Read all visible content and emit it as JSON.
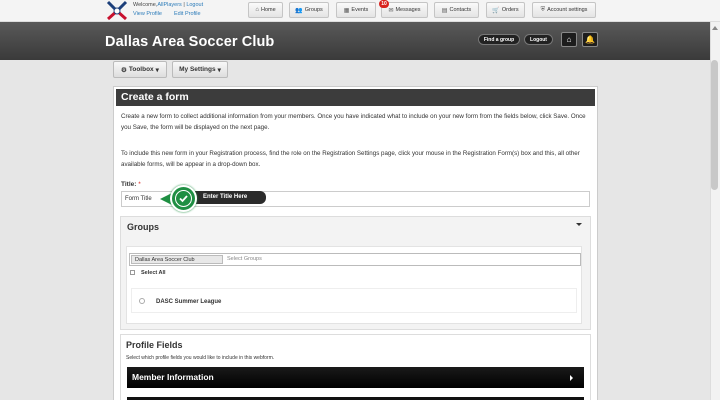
{
  "topbar": {
    "welcome_prefix": "Welcome,",
    "user_name": "AllPlayers",
    "separator": " | ",
    "logout": "Logout",
    "view_profile": "View Profile",
    "edit_profile": "Edit Profile",
    "nav": [
      {
        "label": "Home",
        "icon": "home-icon"
      },
      {
        "label": "Groups",
        "icon": "users-icon"
      },
      {
        "label": "Events",
        "icon": "calendar-icon"
      },
      {
        "label": "Messages",
        "icon": "envelope-icon"
      },
      {
        "label": "Contacts",
        "icon": "address-book-icon"
      },
      {
        "label": "Orders",
        "icon": "cart-icon"
      },
      {
        "label": "Account settings",
        "icon": "shield-icon"
      }
    ],
    "messages_badge": "10"
  },
  "header": {
    "club_name": "Dallas Area Soccer Club",
    "find_group": "Find a group",
    "logout": "Logout"
  },
  "toolbar": {
    "toolbox": "Toolbox",
    "my_settings": "My Settings"
  },
  "form": {
    "heading": "Create a form",
    "intro": "Create a new form to collect additional information from your members. Once you have indicated what to include on your new form from the fields below, click Save. Once you Save, the form will be displayed on the next page.",
    "registration_note": "To include this new form in your Registration process, find the role on the Registration Settings page, click your mouse in the Registration Form(s) box and this, all other available forms, will be appear in a drop-down box.",
    "title_label": "Title:",
    "required_mark": "*",
    "title_value": "Form Title",
    "tooltip": "Enter Title Here"
  },
  "groups": {
    "heading": "Groups",
    "selected_chip": "Dallas Area Soccer Club",
    "placeholder": "Select Groups",
    "select_all": "Select All",
    "items": [
      "DASC Summer League"
    ]
  },
  "profile_fields": {
    "heading": "Profile Fields",
    "subtitle": "Select which profile fields you would like to include in this webform.",
    "sections": [
      "Member Information"
    ]
  },
  "colors": {
    "header_dark": "#3c3c3c",
    "accent_green": "#1f8f43",
    "link_blue": "#2b7bb9",
    "badge_red": "#d9231e"
  }
}
